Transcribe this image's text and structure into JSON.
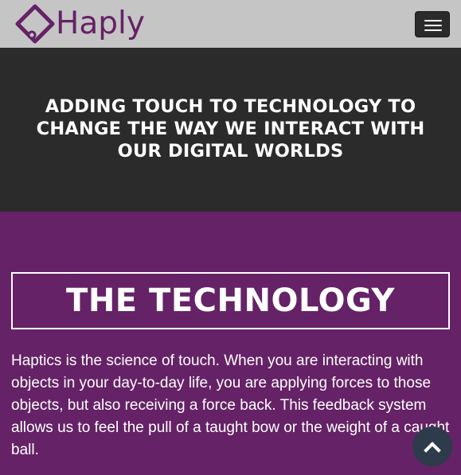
{
  "navbar": {
    "brand_text": "Haply",
    "brand_color": "#652266",
    "logo_icon": "haply-diamond-logo-icon",
    "toggle_icon": "hamburger-menu-icon"
  },
  "hero": {
    "title": "ADDING TOUCH TO TECHNOLOGY TO CHANGE THE WAY WE INTERACT WITH OUR DIGITAL WORLDS"
  },
  "technology": {
    "heading": "THE TECHNOLOGY",
    "body": "Haptics is the science of touch. When you are interacting with objects in your day-to-day life, you are applying forces to those objects, but also receiving a force back. This feedback system allows us to feel the pull of a taught bow or the weight of a caught ball."
  },
  "scroll_top": {
    "icon": "chevron-up-icon"
  },
  "colors": {
    "navbar_bg": "#c5c5c5",
    "hero_bg": "#2b2b2b",
    "section_bg": "#652266",
    "scroll_button_bg": "#2d3b4a"
  }
}
